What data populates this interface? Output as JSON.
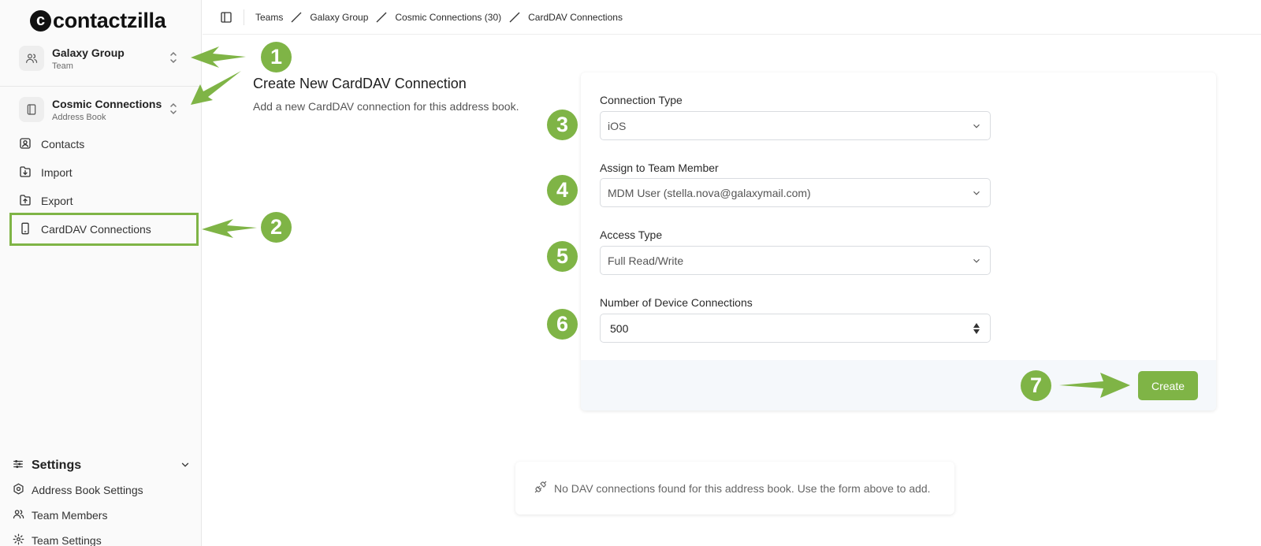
{
  "app": {
    "logo_text": "contactzilla"
  },
  "team_switcher": {
    "title": "Galaxy Group",
    "subtitle": "Team"
  },
  "book_switcher": {
    "title": "Cosmic Connections",
    "subtitle": "Address Book"
  },
  "nav": {
    "items": [
      {
        "label": "Contacts",
        "icon": "contact-card-icon"
      },
      {
        "label": "Import",
        "icon": "import-icon"
      },
      {
        "label": "Export",
        "icon": "export-icon"
      },
      {
        "label": "CardDAV Connections",
        "icon": "phone-icon",
        "active": true
      }
    ]
  },
  "settings": {
    "title": "Settings",
    "items": [
      {
        "label": "Address Book Settings",
        "icon": "settings-icon"
      },
      {
        "label": "Team Members",
        "icon": "users-icon"
      },
      {
        "label": "Team Settings",
        "icon": "gear-icon"
      }
    ]
  },
  "breadcrumbs": [
    "Teams",
    "Galaxy Group",
    "Cosmic Connections (30)",
    "CardDAV Connections"
  ],
  "page": {
    "title": "Create New CardDAV Connection",
    "subtitle": "Add a new CardDAV connection for this address book."
  },
  "form": {
    "connection_type": {
      "label": "Connection Type",
      "value": "iOS"
    },
    "team_member": {
      "label": "Assign to Team Member",
      "value": "MDM User (stella.nova@galaxymail.com)"
    },
    "access_type": {
      "label": "Access Type",
      "value": "Full Read/Write"
    },
    "device_connections": {
      "label": "Number of Device Connections",
      "value": "500"
    },
    "create_label": "Create"
  },
  "empty_state": {
    "message": "No DAV connections found for this address book. Use the form above to add."
  },
  "annotations": [
    "1",
    "2",
    "3",
    "4",
    "5",
    "6",
    "7"
  ],
  "colors": {
    "accent": "#7fb446",
    "sidebar_bg": "#fafafa"
  }
}
